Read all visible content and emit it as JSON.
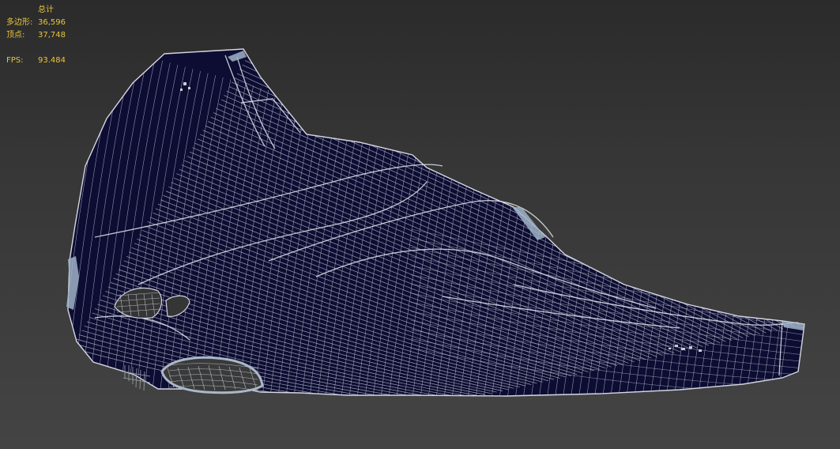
{
  "viewport": {
    "background_top": "#2b2b2b",
    "background_bottom": "#444444",
    "stats_color": "#e8c53a",
    "mesh_fill": "#0d0d33",
    "wire_color": "#c7c9d6",
    "highlight_color": "#9fb3c8"
  },
  "stats": {
    "header": "总计",
    "polygons_label": "多边形:",
    "polygons_value": "36,596",
    "vertices_label": "顶点:",
    "vertices_value": "37,748",
    "fps_label": "FPS:",
    "fps_value": "93.484"
  }
}
